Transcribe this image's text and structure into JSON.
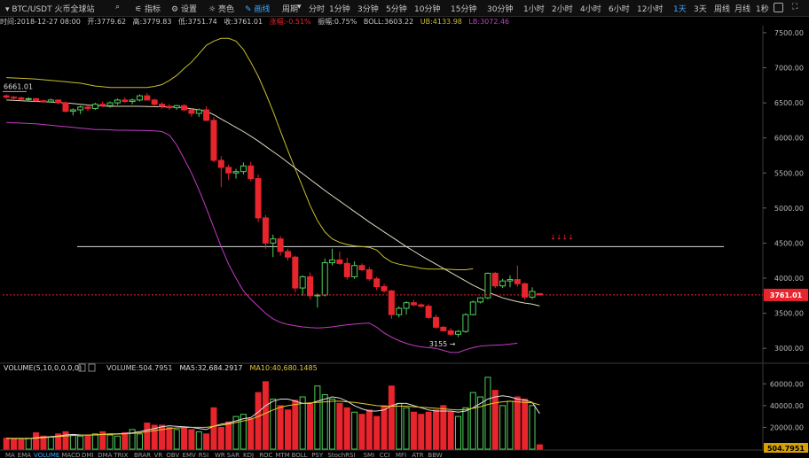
{
  "toolbar": {
    "pair": "BTC/USDT 火币全球站",
    "indicator_label": "指标",
    "settings_label": "设置",
    "theme_label": "亮色",
    "draw_label": "画线",
    "period_label": "周期",
    "periods": [
      "分时",
      "1分钟",
      "3分钟",
      "5分钟",
      "10分钟",
      "15分钟",
      "30分钟",
      "1小时",
      "2小时",
      "4小时",
      "6小时",
      "12小时",
      "1天",
      "3天",
      "周线",
      "月线"
    ],
    "active_period": "1天",
    "refresh": "1秒"
  },
  "info": {
    "time": "时间:2018-12-27 08:00",
    "open": "开:3779.62",
    "high": "高:3779.83",
    "low": "低:3751.74",
    "close": "收:3761.01",
    "change": "涨幅:-0.51%",
    "amplitude": "振幅:0.75%",
    "boll": "BOLL:3603.22",
    "ub": "UB:4133.98",
    "lb": "LB:3072.46"
  },
  "colors": {
    "up": "#4fd15a",
    "down": "#e8242d",
    "mid": "#e0d8c0",
    "ub": "#c8be2c",
    "lb": "#c43cc4",
    "grid": "#202020",
    "ma5": "#e0e0e0",
    "ma10": "#e2c92f"
  },
  "chart_data": [
    {
      "type": "candlestick",
      "title": "BTC/USDT",
      "ylim": [
        2800,
        7600
      ],
      "yticks": [
        3000,
        3500,
        4000,
        4500,
        5000,
        5500,
        6000,
        6500,
        7000,
        7500
      ],
      "tick_labels": [
        "3000.00",
        "3500.00",
        "4000.00",
        "4500.00",
        "5000.00",
        "5500.00",
        "6000.00",
        "6500.00",
        "7000.00",
        "7500.00"
      ],
      "candles": [
        [
          6600,
          6620,
          6560,
          6580
        ],
        [
          6580,
          6600,
          6550,
          6570
        ],
        [
          6570,
          6590,
          6530,
          6550
        ],
        [
          6550,
          6580,
          6520,
          6560
        ],
        [
          6560,
          6570,
          6510,
          6530
        ],
        [
          6530,
          6545,
          6500,
          6515
        ],
        [
          6515,
          6560,
          6505,
          6540
        ],
        [
          6540,
          6550,
          6480,
          6500
        ],
        [
          6500,
          6520,
          6360,
          6380
        ],
        [
          6380,
          6420,
          6320,
          6400
        ],
        [
          6400,
          6460,
          6340,
          6440
        ],
        [
          6440,
          6470,
          6380,
          6420
        ],
        [
          6420,
          6500,
          6400,
          6480
        ],
        [
          6480,
          6520,
          6440,
          6460
        ],
        [
          6460,
          6520,
          6430,
          6500
        ],
        [
          6500,
          6560,
          6470,
          6540
        ],
        [
          6540,
          6580,
          6500,
          6520
        ],
        [
          6520,
          6560,
          6480,
          6540
        ],
        [
          6540,
          6620,
          6520,
          6600
        ],
        [
          6600,
          6640,
          6560,
          6540
        ],
        [
          6540,
          6560,
          6460,
          6480
        ],
        [
          6480,
          6510,
          6420,
          6450
        ],
        [
          6450,
          6480,
          6400,
          6430
        ],
        [
          6430,
          6470,
          6400,
          6460
        ],
        [
          6460,
          6480,
          6380,
          6400
        ],
        [
          6400,
          6420,
          6300,
          6350
        ],
        [
          6350,
          6420,
          6300,
          6400
        ],
        [
          6400,
          6450,
          6240,
          6250
        ],
        [
          6250,
          6300,
          5650,
          5680
        ],
        [
          5680,
          5740,
          5300,
          5580
        ],
        [
          5580,
          5620,
          5400,
          5500
        ],
        [
          5500,
          5560,
          5420,
          5520
        ],
        [
          5520,
          5650,
          5480,
          5600
        ],
        [
          5600,
          5660,
          5380,
          5420
        ],
        [
          5420,
          5480,
          4800,
          4860
        ],
        [
          4860,
          4900,
          4420,
          4500
        ],
        [
          4500,
          4620,
          4300,
          4560
        ],
        [
          4560,
          4600,
          4320,
          4380
        ],
        [
          4380,
          4420,
          4250,
          4300
        ],
        [
          4300,
          4320,
          3800,
          3860
        ],
        [
          3860,
          4040,
          3750,
          4020
        ],
        [
          4020,
          4080,
          3700,
          3750
        ],
        [
          3750,
          3780,
          3580,
          3760
        ],
        [
          3760,
          4280,
          3740,
          4220
        ],
        [
          4220,
          4420,
          4180,
          4260
        ],
        [
          4260,
          4380,
          4190,
          4210
        ],
        [
          4210,
          4290,
          3980,
          4020
        ],
        [
          4020,
          4240,
          3990,
          4180
        ],
        [
          4180,
          4210,
          4100,
          4120
        ],
        [
          4120,
          4160,
          3960,
          3990
        ],
        [
          3990,
          4020,
          3830,
          3880
        ],
        [
          3880,
          3920,
          3790,
          3820
        ],
        [
          3820,
          3830,
          3420,
          3480
        ],
        [
          3480,
          3600,
          3440,
          3570
        ],
        [
          3570,
          3670,
          3480,
          3650
        ],
        [
          3650,
          3690,
          3600,
          3620
        ],
        [
          3620,
          3640,
          3580,
          3600
        ],
        [
          3600,
          3630,
          3420,
          3440
        ],
        [
          3440,
          3480,
          3280,
          3300
        ],
        [
          3300,
          3320,
          3240,
          3250
        ],
        [
          3250,
          3290,
          3180,
          3200
        ],
        [
          3200,
          3260,
          3160,
          3240
        ],
        [
          3240,
          3500,
          3220,
          3480
        ],
        [
          3480,
          3680,
          3470,
          3660
        ],
        [
          3660,
          3730,
          3640,
          3720
        ],
        [
          3720,
          4080,
          3700,
          4070
        ],
        [
          4070,
          4090,
          3860,
          3890
        ],
        [
          3890,
          3990,
          3860,
          3960
        ],
        [
          3960,
          4040,
          3870,
          3980
        ],
        [
          3980,
          4180,
          3880,
          3920
        ],
        [
          3920,
          3940,
          3690,
          3730
        ],
        [
          3730,
          3870,
          3700,
          3810
        ],
        [
          3779.62,
          3779.83,
          3751.74,
          3761.01
        ]
      ],
      "mid": [
        6540,
        6535,
        6530,
        6525,
        6520,
        6515,
        6510,
        6505,
        6500,
        6490,
        6480,
        6470,
        6460,
        6455,
        6450,
        6450,
        6450,
        6450,
        6450,
        6448,
        6446,
        6444,
        6442,
        6440,
        6430,
        6415,
        6400,
        6380,
        6330,
        6270,
        6210,
        6150,
        6090,
        6025,
        5955,
        5880,
        5805,
        5730,
        5650,
        5570,
        5490,
        5410,
        5330,
        5250,
        5175,
        5100,
        5025,
        4950,
        4875,
        4800,
        4730,
        4660,
        4590,
        4520,
        4450,
        4385,
        4320,
        4260,
        4200,
        4140,
        4080,
        4020,
        3960,
        3900,
        3850,
        3800,
        3760,
        3720,
        3690,
        3665,
        3645,
        3630,
        3603.22
      ],
      "ub": [
        6860,
        6855,
        6850,
        6845,
        6840,
        6830,
        6820,
        6810,
        6800,
        6790,
        6780,
        6760,
        6740,
        6730,
        6720,
        6720,
        6720,
        6720,
        6720,
        6720,
        6735,
        6760,
        6820,
        6890,
        6990,
        7080,
        7200,
        7320,
        7380,
        7420,
        7420,
        7380,
        7260,
        7080,
        6880,
        6640,
        6380,
        6100,
        5820,
        5560,
        5300,
        5040,
        4820,
        4660,
        4560,
        4510,
        4480,
        4460,
        4450,
        4440,
        4400,
        4300,
        4230,
        4200,
        4180,
        4160,
        4140,
        4130,
        4130,
        4130,
        4125,
        4120,
        4120,
        4133.98
      ],
      "lb": [
        6220,
        6215,
        6210,
        6205,
        6200,
        6190,
        6180,
        6170,
        6160,
        6150,
        6140,
        6130,
        6120,
        6120,
        6115,
        6110,
        6110,
        6108,
        6106,
        6104,
        6100,
        6090,
        6040,
        5900,
        5700,
        5500,
        5260,
        5000,
        4720,
        4450,
        4200,
        4000,
        3820,
        3700,
        3600,
        3500,
        3420,
        3370,
        3340,
        3320,
        3305,
        3295,
        3290,
        3295,
        3305,
        3320,
        3335,
        3345,
        3355,
        3360,
        3300,
        3220,
        3160,
        3110,
        3070,
        3040,
        3020,
        3010,
        3000,
        2970,
        2940,
        2940,
        2980,
        3010,
        3030,
        3040,
        3045,
        3050,
        3060,
        3072.46
      ],
      "high_marker": {
        "label": "6661.01",
        "value": 6661.01
      },
      "low_marker": {
        "label": "3155",
        "value": 3155
      },
      "current_price": {
        "label": "3761.01",
        "value": 3761.01
      },
      "horizontal_line": 4450,
      "annotation_text": "↓↓↓↓"
    },
    {
      "type": "bar",
      "title": "VOLUME(5,10,0,0,0,0)",
      "legend": [
        {
          "text": "VOLUME:504.7951",
          "color": "#cfcfcf"
        },
        {
          "text": "MA5:32,684.2917",
          "color": "#e0e0e0"
        },
        {
          "text": "MA10:40,680.1485",
          "color": "#e2c92f"
        }
      ],
      "ylim": [
        0,
        70000
      ],
      "yticks": [
        20000,
        40000,
        60000
      ],
      "tick_labels": [
        "20000.00",
        "40000.00",
        "60000.00"
      ],
      "last_label": "504.7951",
      "values": [
        10000,
        9000,
        8500,
        10000,
        15000,
        12000,
        11000,
        14000,
        16000,
        13000,
        12000,
        12000,
        14000,
        16000,
        13000,
        12000,
        15000,
        18000,
        14000,
        24000,
        22000,
        22000,
        20000,
        18000,
        19000,
        18000,
        16000,
        14000,
        38000,
        20000,
        25000,
        30000,
        32000,
        28000,
        52000,
        62000,
        46000,
        40000,
        36000,
        45000,
        48000,
        42000,
        58000,
        50000,
        46000,
        42000,
        38000,
        34000,
        32000,
        36000,
        30000,
        40000,
        58000,
        42000,
        38000,
        34000,
        32000,
        34000,
        36000,
        40000,
        34000,
        30000,
        38000,
        52000,
        48000,
        66000,
        54000,
        40000,
        44000,
        48000,
        46000,
        40000,
        4000
      ],
      "ma5": [
        10000,
        9800,
        9600,
        9500,
        10500,
        11000,
        11500,
        12000,
        13000,
        13500,
        13000,
        12800,
        13000,
        13500,
        14000,
        14200,
        14500,
        15000,
        16000,
        17500,
        19000,
        20500,
        21500,
        21000,
        20500,
        20000,
        19000,
        18000,
        21000,
        23000,
        24000,
        26000,
        28000,
        29000,
        34000,
        40000,
        44000,
        46000,
        46000,
        44000,
        42000,
        42000,
        44000,
        46000,
        48000,
        47000,
        44000,
        40000,
        37000,
        35000,
        35000,
        36000,
        40000,
        42000,
        42000,
        40000,
        38000,
        36000,
        35000,
        35000,
        35000,
        34000,
        35000,
        38000,
        42000,
        46000,
        48000,
        49000,
        48000,
        46000,
        45000,
        43000,
        32684
      ],
      "ma10": [
        10000,
        10000,
        9900,
        9800,
        10000,
        10500,
        11000,
        11500,
        12000,
        12500,
        12800,
        13000,
        13200,
        13400,
        13600,
        13800,
        14000,
        14500,
        15000,
        16000,
        17000,
        18000,
        19000,
        19500,
        19800,
        20000,
        20000,
        20000,
        21000,
        22000,
        23000,
        24500,
        26000,
        27500,
        30000,
        33000,
        36000,
        38500,
        40000,
        41000,
        42000,
        42500,
        43000,
        43500,
        44000,
        44000,
        43500,
        43000,
        42000,
        41000,
        40000,
        39500,
        39500,
        39500,
        39500,
        39000,
        38500,
        38000,
        37500,
        37000,
        36500,
        36000,
        36500,
        37500,
        39000,
        41000,
        42500,
        43500,
        44000,
        43500,
        43000,
        42500,
        40680
      ]
    }
  ],
  "bottom_tabs": [
    "MA",
    "EMA",
    "VOLUME",
    "MACD",
    "DMI",
    "DMA",
    "TRIX",
    "BRAR",
    "VR",
    "OBV",
    "EMV",
    "RSI",
    "WR",
    "SAR",
    "KDJ",
    "ROC",
    "MTM",
    "BOLL",
    "PSY",
    "StochRSI",
    "SMI",
    "CCI",
    "MFI",
    "ATR",
    "BBW"
  ],
  "active_tab": "VOLUME"
}
